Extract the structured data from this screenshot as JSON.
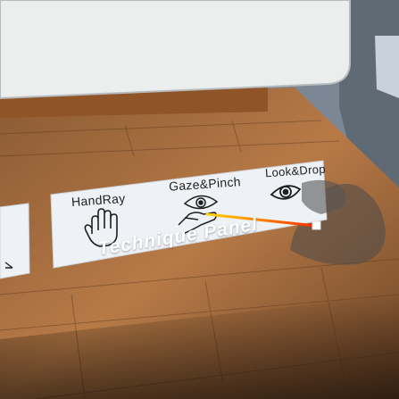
{
  "panel": {
    "title": "Technique Panel",
    "techniques": [
      {
        "label": "HandRay",
        "icon": "hand-icon"
      },
      {
        "label": "Gaze&Pinch",
        "icon": "eye-pinch-icon"
      },
      {
        "label": "Look&Drop",
        "icon": "eye-icon"
      }
    ]
  },
  "colors": {
    "panel_bg": "#eef1f5",
    "table_wood": "#b07644",
    "ray_start": "#ffd400",
    "ray_end": "#ff3300"
  }
}
